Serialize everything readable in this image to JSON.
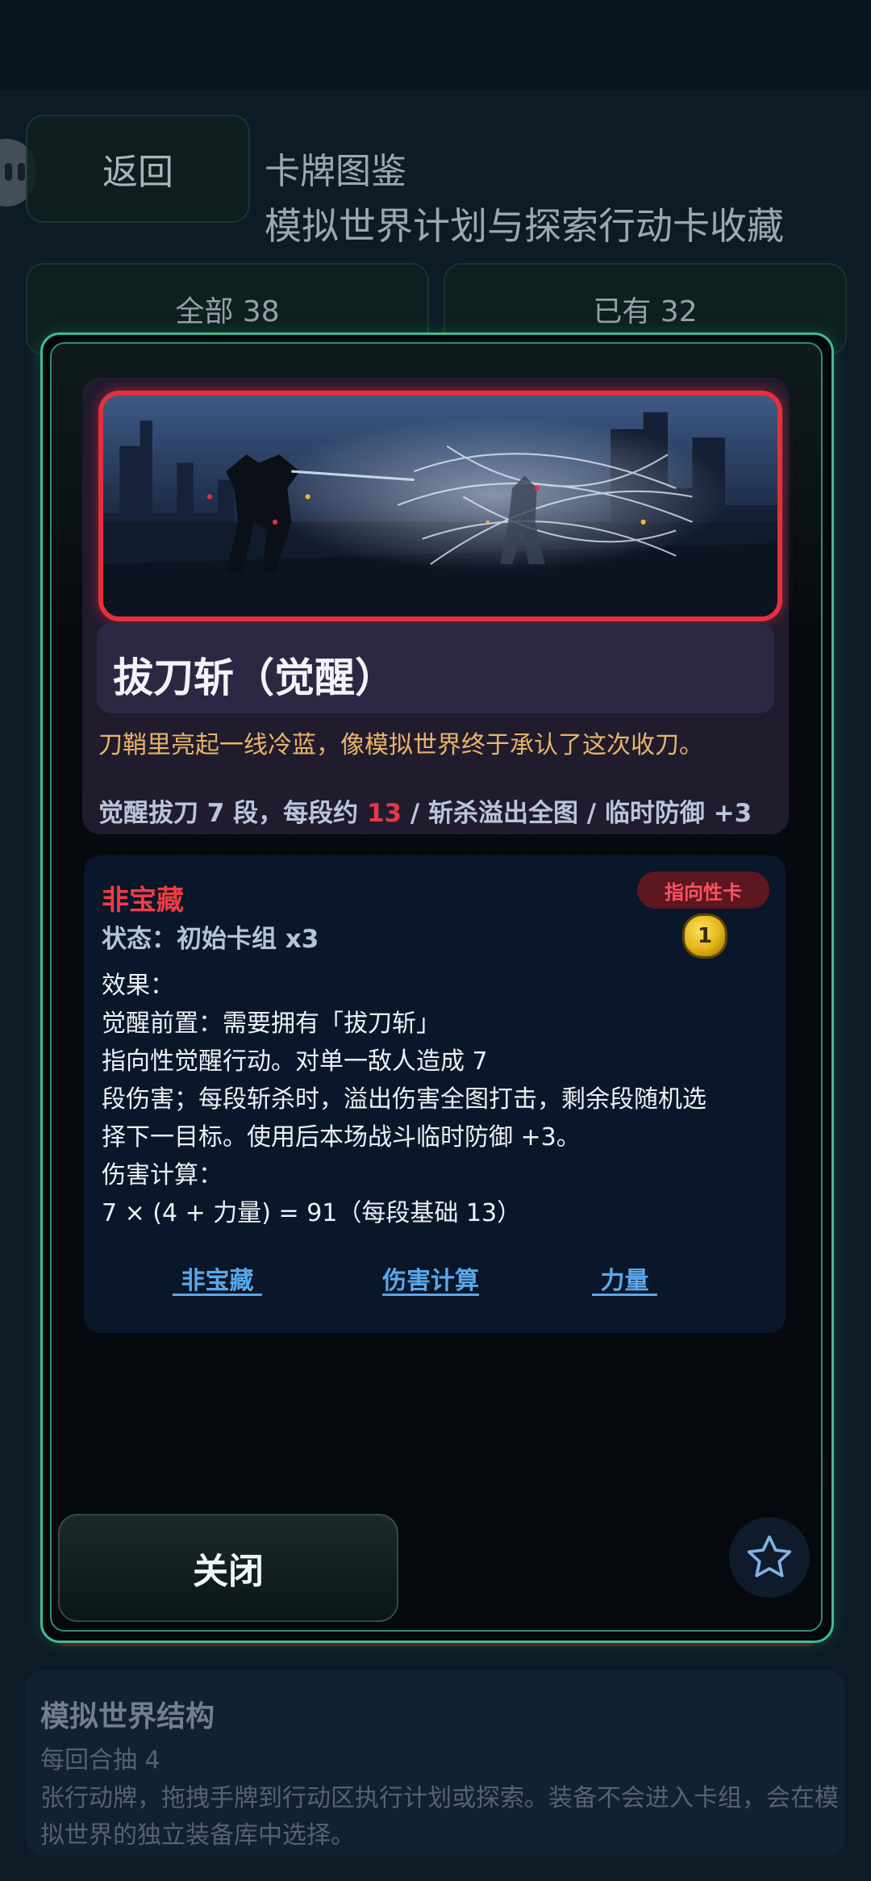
{
  "background": {
    "back_label": "返回",
    "title": "卡牌图鉴",
    "subtitle": "模拟世界计划与探索行动卡收藏",
    "tab_all": "全部 38",
    "tab_owned": "已有 32",
    "info_card": {
      "title": "模拟世界结构",
      "line1": "每回合抽 4",
      "line2": "张行动牌，拖拽手牌到行动区执行计划或探索。装备不会进入卡组，会在模拟世界的独立装备库中选择。"
    }
  },
  "card": {
    "name": "拔刀斩（觉醒）",
    "flavor": "刀鞘里亮起一线冷蓝，像模拟世界终于承认了这次收刀。",
    "stats_prefix": "觉醒拔刀 7 段，每段约 ",
    "stats_highlight": "13",
    "stats_suffix": " / 斩杀溢出全图 / 临时防御 +3",
    "rarity": "非宝藏",
    "status": "状态：初始卡组 x3",
    "type_badge": "指向性卡",
    "cost": "1",
    "effect_lines": [
      "效果：",
      "觉醒前置：需要拥有「拔刀斩」",
      "指向性觉醒行动。对单一敌人造成 7",
      "段伤害；每段斩杀时，溢出伤害全图打击，剩余段随机选",
      "择下一目标。使用后本场战斗临时防御 +3。",
      "伤害计算：",
      "7 × (4 + 力量) = 91（每段基础 13）"
    ],
    "keywords": [
      " 非宝藏 ",
      "伤害计算",
      " 力量 "
    ]
  },
  "modal": {
    "close_label": "关闭"
  },
  "colors": {
    "accent_green": "#3fbd93",
    "frame_red": "#e5303c",
    "flavor_gold": "#e8b567",
    "keyword_blue": "#5aa8ea"
  },
  "icons": {
    "favorite": "star-icon",
    "cost": "coin-icon"
  }
}
